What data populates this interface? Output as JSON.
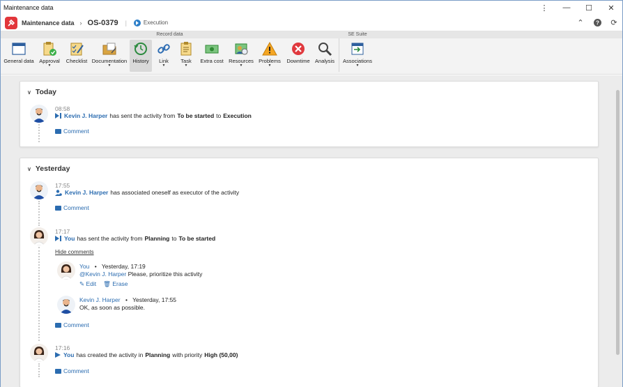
{
  "window": {
    "title": "Maintenance data"
  },
  "header": {
    "breadcrumb_root": "Maintenance data",
    "record_id": "OS-0379",
    "status": "Execution"
  },
  "ribbon": {
    "group_record": "Record data",
    "group_suite": "SE Suite",
    "buttons": {
      "general": "General data",
      "approval": "Approval",
      "checklist": "Checklist",
      "documentation": "Documentation",
      "history": "History",
      "link": "Link",
      "task": "Task",
      "extra_cost": "Extra cost",
      "resources": "Resources",
      "problems": "Problems",
      "downtime": "Downtime",
      "analysis": "Analysis",
      "associations": "Associations"
    }
  },
  "today": {
    "title": "Today",
    "e1": {
      "time": "08:58",
      "user": "Kevin J. Harper",
      "t1": "has sent the activity from",
      "from": "To be started",
      "t2": "to",
      "to": "Execution",
      "comment": "Comment"
    }
  },
  "yesterday": {
    "title": "Yesterday",
    "e1": {
      "time": "17:55",
      "user": "Kevin J. Harper",
      "t1": "has associated oneself as executor of the activity",
      "comment": "Comment"
    },
    "e2": {
      "time": "17:17",
      "user": "You",
      "t1": "has sent the activity from",
      "from": "Planning",
      "t2": "to",
      "to": "To be started",
      "hide_comments": "Hide comments",
      "c1": {
        "author": "You",
        "bullet": "•",
        "when": "Yesterday, 17:19",
        "mention": "@Kevin J. Harper",
        "text": "Please, prioritize this activity",
        "edit": "Edit",
        "erase": "Erase"
      },
      "c2": {
        "author": "Kevin J. Harper",
        "bullet": "•",
        "when": "Yesterday, 17:55",
        "text": "OK, as soon as possible."
      },
      "comment": "Comment"
    },
    "e3": {
      "time": "17:16",
      "user": "You",
      "t1": "has created the activity in",
      "where": "Planning",
      "t2": "with priority",
      "priority": "High (50,00)",
      "comment": "Comment"
    }
  },
  "colors": {
    "accent": "#2b6cb0",
    "logo": "#e2363b"
  }
}
